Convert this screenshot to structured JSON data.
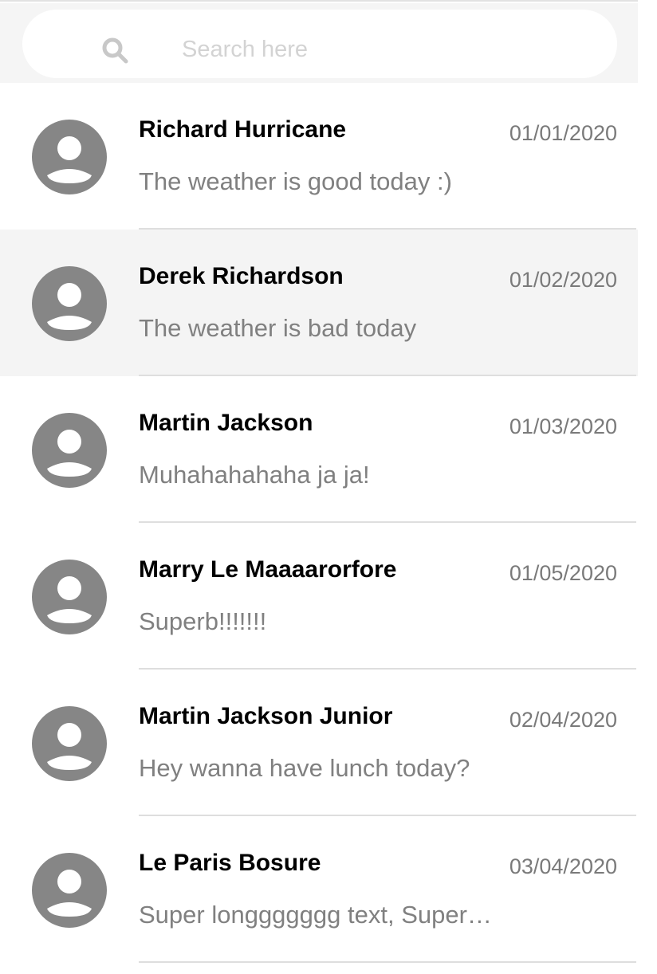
{
  "search": {
    "placeholder": "Search here",
    "value": ""
  },
  "icons": {
    "search": "search-icon",
    "avatar": "user-avatar-icon"
  },
  "colors": {
    "avatar": "#868686",
    "selected_row": "#f4f4f4",
    "search_bar_bg": "#f5f5f5"
  },
  "conversations": [
    {
      "name": "Richard Hurricane",
      "date": "01/01/2020",
      "preview": "The weather is good today :)",
      "selected": false
    },
    {
      "name": "Derek Richardson",
      "date": "01/02/2020",
      "preview": "The weather is bad today",
      "selected": true
    },
    {
      "name": "Martin Jackson",
      "date": "01/03/2020",
      "preview": "Muhahahahaha ja ja!",
      "selected": false
    },
    {
      "name": "Marry Le Maaaarorfore",
      "date": "01/05/2020",
      "preview": "Superb!!!!!!!",
      "selected": false
    },
    {
      "name": "Martin Jackson Junior",
      "date": "02/04/2020",
      "preview": "Hey wanna have lunch today?",
      "selected": false
    },
    {
      "name": "Le Paris Bosure",
      "date": "03/04/2020",
      "preview": "Super longgggggg text, Super longgggggg text",
      "selected": false
    }
  ]
}
